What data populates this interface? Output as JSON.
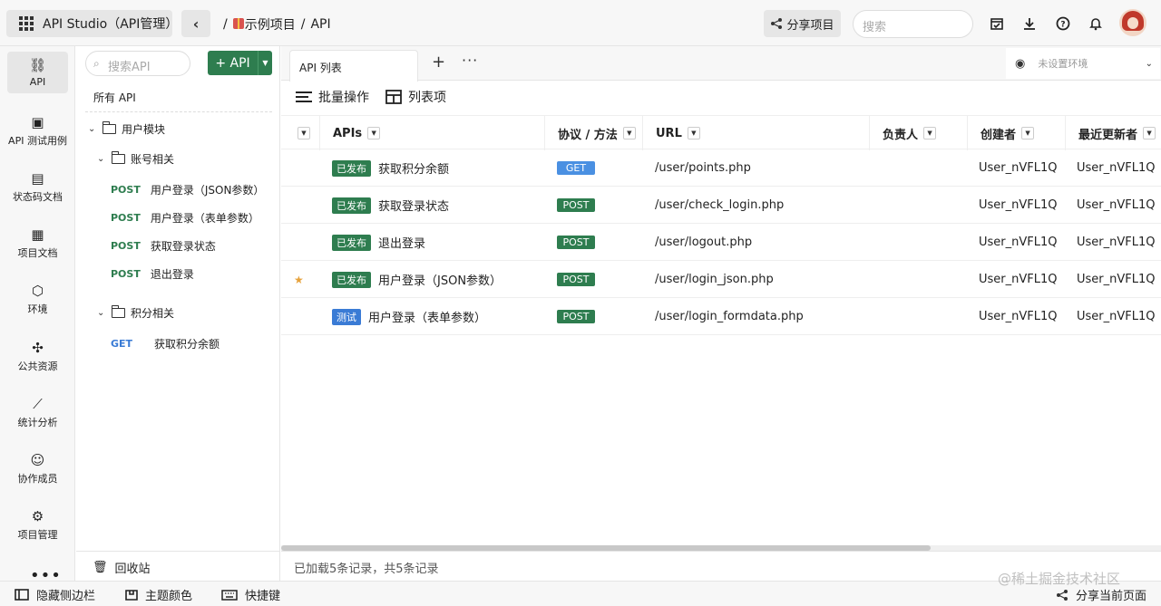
{
  "header": {
    "app_title": "API Studio（API管理）",
    "breadcrumb": [
      "/",
      "示例项目",
      "/",
      "API"
    ],
    "share_label": "分享项目",
    "search_placeholder": "搜索"
  },
  "rail": {
    "items": [
      {
        "label": "API",
        "icon": "link-icon"
      },
      {
        "label": "API 测试用例",
        "icon": "clipboard-icon"
      },
      {
        "label": "状态码文档",
        "icon": "note-icon"
      },
      {
        "label": "项目文档",
        "icon": "document-icon"
      },
      {
        "label": "环境",
        "icon": "cube-icon"
      },
      {
        "label": "公共资源",
        "icon": "puzzle-icon"
      },
      {
        "label": "统计分析",
        "icon": "chart-icon"
      },
      {
        "label": "协作成员",
        "icon": "user-icon"
      },
      {
        "label": "项目管理",
        "icon": "gear-icon"
      }
    ],
    "more": "•••"
  },
  "tree": {
    "search_placeholder": "搜索API",
    "add_label": "+ API",
    "all_api": "所有 API",
    "module": "用户模块",
    "group1": "账号相关",
    "group1_items": [
      {
        "method": "POST",
        "name": "用户登录（JSON参数）"
      },
      {
        "method": "POST",
        "name": "用户登录（表单参数）"
      },
      {
        "method": "POST",
        "name": "获取登录状态"
      },
      {
        "method": "POST",
        "name": "退出登录"
      }
    ],
    "group2": "积分相关",
    "group2_items": [
      {
        "method": "GET",
        "name": "获取积分余额"
      }
    ],
    "recycle": "回收站"
  },
  "tabs": {
    "active": "API 列表",
    "plus": "+",
    "more": "···",
    "env_placeholder": "未设置环境"
  },
  "toolbar": {
    "batch": "批量操作",
    "columns": "列表项"
  },
  "table": {
    "headers": [
      "APIs",
      "协议 / 方法",
      "URL",
      "负责人",
      "创建者",
      "最近更新者"
    ],
    "rows": [
      {
        "star": "",
        "status": "已发布",
        "name": "获取积分余额",
        "method": "GET",
        "url": "/user/points.php",
        "owner": "",
        "creator": "User_nVFL1Q",
        "updater": "User_nVFL1Q"
      },
      {
        "star": "",
        "status": "已发布",
        "name": "获取登录状态",
        "method": "POST",
        "url": "/user/check_login.php",
        "owner": "",
        "creator": "User_nVFL1Q",
        "updater": "User_nVFL1Q"
      },
      {
        "star": "",
        "status": "已发布",
        "name": "退出登录",
        "method": "POST",
        "url": "/user/logout.php",
        "owner": "",
        "creator": "User_nVFL1Q",
        "updater": "User_nVFL1Q"
      },
      {
        "star": "★",
        "status": "已发布",
        "name": "用户登录（JSON参数）",
        "method": "POST",
        "url": "/user/login_json.php",
        "owner": "",
        "creator": "User_nVFL1Q",
        "updater": "User_nVFL1Q"
      },
      {
        "star": "",
        "status": "测试",
        "name": "用户登录（表单参数）",
        "method": "POST",
        "url": "/user/login_formdata.php",
        "owner": "",
        "creator": "User_nVFL1Q",
        "updater": "User_nVFL1Q"
      }
    ],
    "status_text": "已加载5条记录，共5条记录"
  },
  "bottombar": {
    "hide_sidebar": "隐藏侧边栏",
    "theme": "主题颜色",
    "shortcuts": "快捷键",
    "share_page": "分享当前页面"
  },
  "watermark": "@稀土掘金技术社区",
  "colors": {
    "primary_green": "#2e7d4f",
    "get_blue": "#4a90e2",
    "test_blue": "#3a7bd5",
    "star": "#e6a23c"
  }
}
